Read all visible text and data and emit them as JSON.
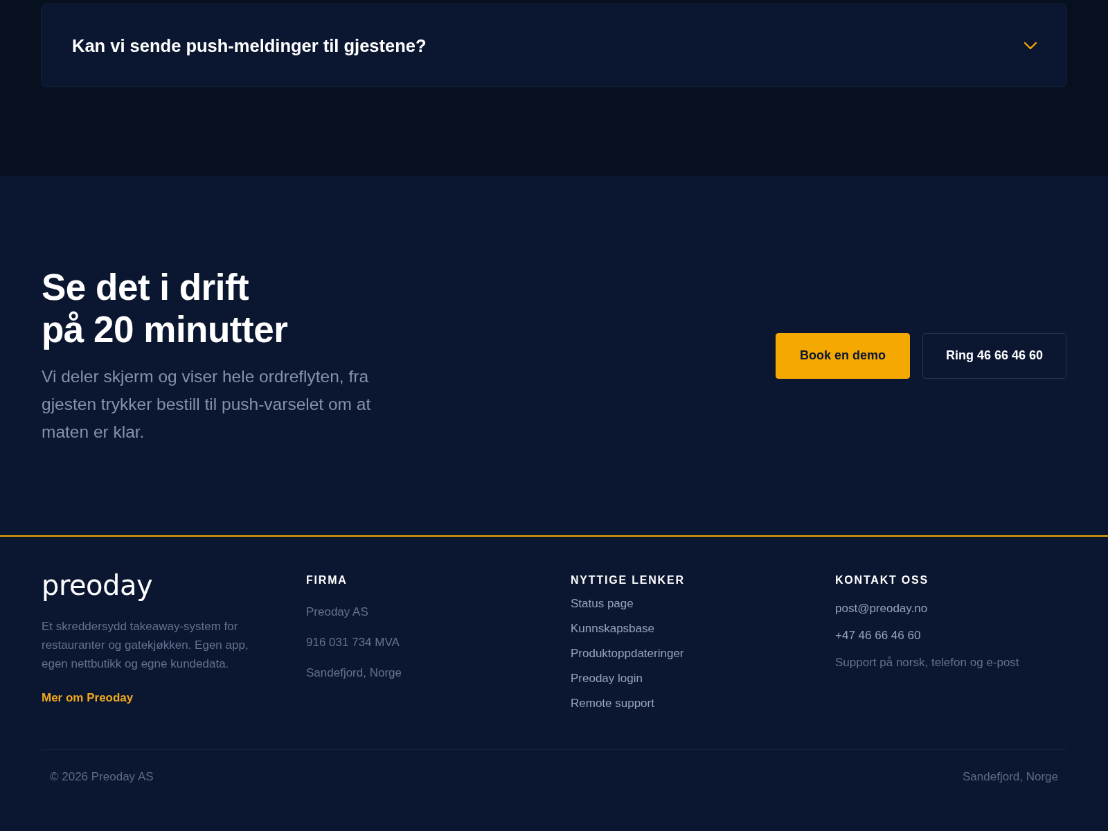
{
  "faq": {
    "items": [
      {
        "question": "Kan vi sende push-meldinger til gjestene?",
        "expanded": false
      }
    ]
  },
  "cta": {
    "title_lines": [
      "Se det i drift",
      "på 20 minutter"
    ],
    "text": "Vi deler skjerm og viser hele ordreflyten, fra gjesten trykker bestill til push-varselet om at maten er klar.",
    "buttons": [
      {
        "label": "Book en demo",
        "kind": "primary"
      },
      {
        "label": "Ring 46 66 46 60",
        "kind": "secondary"
      }
    ]
  },
  "footer": {
    "logo": "preoday",
    "description": "Et skreddersydd takeaway-system for restauranter og gatekjøkken. Egen app, egen nettbutikk og egne kundedata.",
    "link": "Mer om Preoday",
    "columns": [
      {
        "heading": "FIRMA",
        "kind": "details",
        "items": [
          {
            "text": "Preoday AS",
            "kind": "text"
          },
          {
            "text": "916 031 734 MVA",
            "kind": "text"
          },
          {
            "text": "Sandefjord, Norge",
            "kind": "text"
          }
        ]
      },
      {
        "heading": "NYTTIGE LENKER",
        "kind": "links",
        "items": [
          {
            "text": "Status page",
            "kind": "link"
          },
          {
            "text": "Kunnskapsbase",
            "kind": "link"
          },
          {
            "text": "Produktoppdateringer",
            "kind": "link"
          },
          {
            "text": "Preoday login",
            "kind": "link"
          },
          {
            "text": "Remote support",
            "kind": "link"
          }
        ]
      },
      {
        "heading": "KONTAKT OSS",
        "kind": "contact",
        "items": [
          {
            "text": "post@preoday.no",
            "kind": "link"
          },
          {
            "text": "+47 46 66 46 60",
            "kind": "link"
          },
          {
            "text": "Support på norsk, telefon og e-post",
            "kind": "text"
          }
        ]
      }
    ]
  },
  "bottom_bar": {
    "copyright": "© 2026 Preoday AS",
    "location": "Sandefjord, Norge"
  }
}
